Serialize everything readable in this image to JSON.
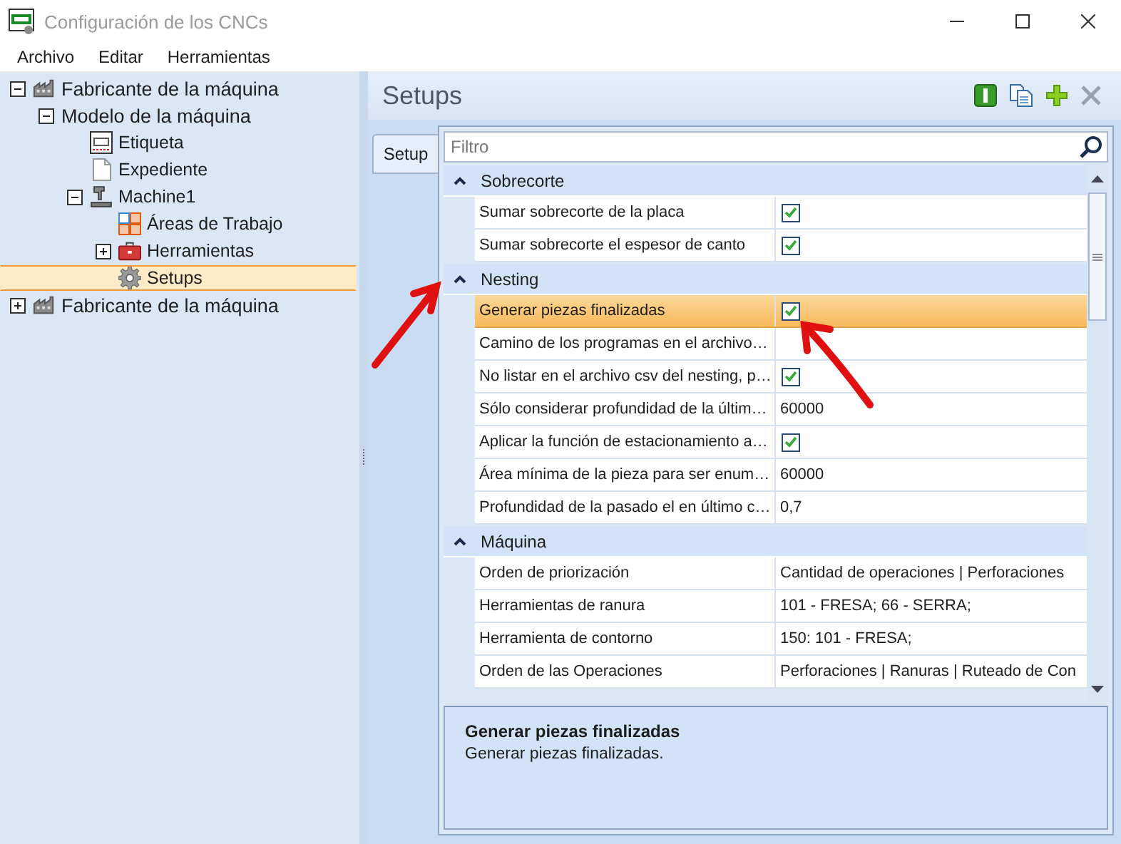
{
  "window": {
    "title": "Configuración de los CNCs"
  },
  "menu": [
    "Archivo",
    "Editar",
    "Herramientas"
  ],
  "tree": [
    {
      "label": "Fabricante de la máquina",
      "kind": "factory",
      "expanded": true,
      "selected": false,
      "children": [
        {
          "label": "Modelo de la máquina",
          "expanded": true,
          "selected": false,
          "children": [
            {
              "label": "Etiqueta",
              "kind": "label",
              "selected": false
            },
            {
              "label": "Expediente",
              "kind": "document",
              "selected": false
            },
            {
              "label": "Machine1",
              "kind": "machine",
              "expanded": true,
              "selected": false,
              "children": [
                {
                  "label": "Áreas de Trabajo",
                  "kind": "areas",
                  "selected": false
                },
                {
                  "label": "Herramientas",
                  "kind": "toolbox",
                  "expanded": false,
                  "selected": false
                },
                {
                  "label": "Setups",
                  "kind": "gear",
                  "selected": true
                }
              ]
            }
          ]
        }
      ]
    },
    {
      "label": "Fabricante de la máquina",
      "kind": "factory",
      "expanded": false,
      "selected": false
    }
  ],
  "panel": {
    "title": "Setups"
  },
  "tabs": [
    {
      "label": "Setup",
      "selected": true
    }
  ],
  "filter": {
    "placeholder": "Filtro"
  },
  "categories": [
    {
      "name": "Sobrecorte",
      "expanded": true,
      "properties": [
        {
          "name": "Sumar sobrecorte de la placa",
          "kind": "checkbox",
          "checked": true,
          "selected": false
        },
        {
          "name": "Sumar sobrecorte el espesor de canto",
          "kind": "checkbox",
          "checked": true,
          "selected": false
        }
      ]
    },
    {
      "name": "Nesting",
      "expanded": true,
      "properties": [
        {
          "name": "Generar piezas finalizadas",
          "kind": "checkbox",
          "checked": true,
          "selected": true
        },
        {
          "name": "Camino de los programas en el archivo…",
          "kind": "text",
          "selected": false
        },
        {
          "name": "No listar en el archivo csv del nesting, p…",
          "kind": "checkbox",
          "checked": true,
          "selected": false
        },
        {
          "name": "Sólo considerar profundidad de la últim…",
          "kind": "text",
          "value": "60000",
          "selected": false
        },
        {
          "name": "Aplicar la función de estacionamiento a…",
          "kind": "checkbox",
          "checked": true,
          "selected": false
        },
        {
          "name": "Área mínima de la pieza para ser enum…",
          "kind": "text",
          "value": "60000",
          "selected": false
        },
        {
          "name": "Profundidad de la pasado el en último c…",
          "kind": "text",
          "value": "0,7",
          "selected": false
        }
      ]
    },
    {
      "name": "Máquina",
      "expanded": true,
      "properties": [
        {
          "name": "Orden de priorización",
          "kind": "text",
          "value": "Cantidad de operaciones | Perforaciones",
          "selected": false
        },
        {
          "name": "Herramientas de ranura",
          "kind": "text",
          "value": "101 - FRESA; 66 - SERRA;",
          "selected": false
        },
        {
          "name": "Herramienta de contorno",
          "kind": "text",
          "value": "150: 101 - FRESA;",
          "selected": false
        },
        {
          "name": "Orden de las Operaciones",
          "kind": "text",
          "value": "Perforaciones | Ranuras | Ruteado de Con",
          "selected": false
        }
      ]
    }
  ],
  "description": {
    "title": "Generar piezas finalizadas",
    "text": "Generar piezas finalizadas."
  }
}
